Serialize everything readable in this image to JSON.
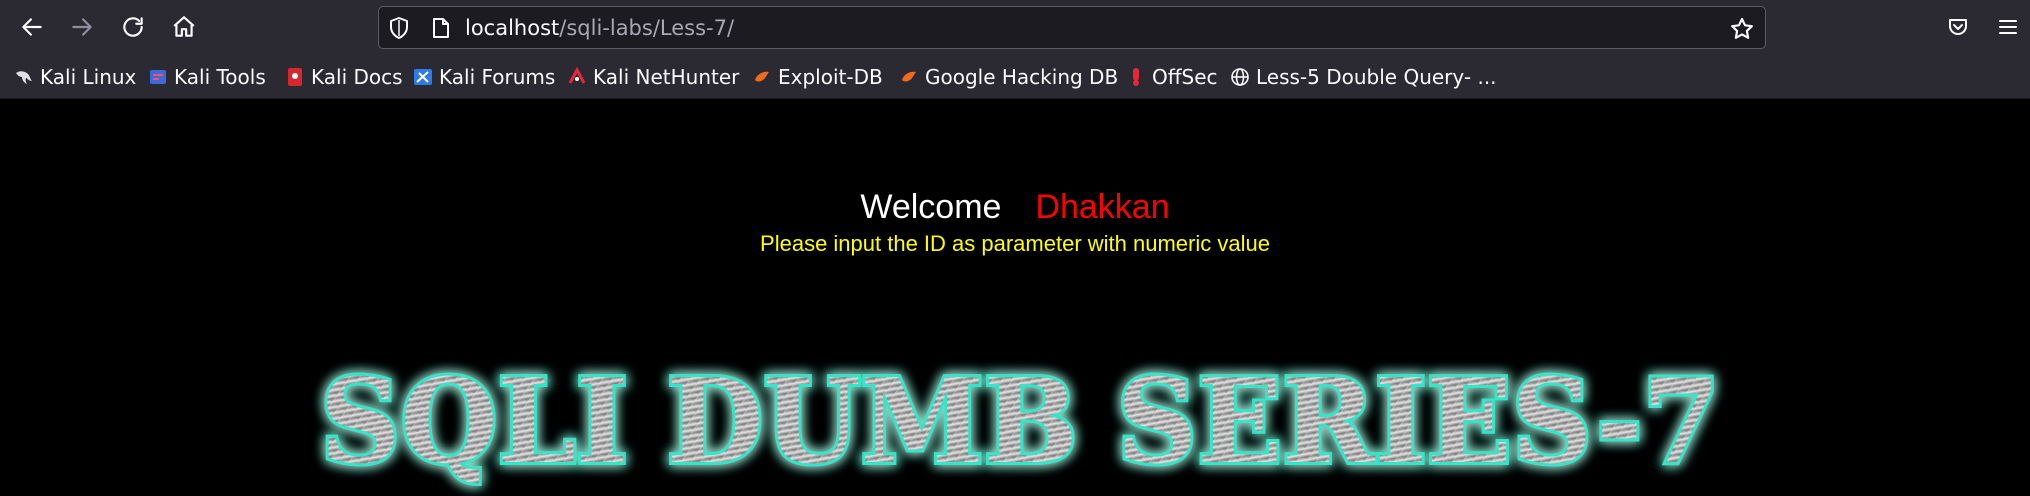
{
  "browser": {
    "url_host": "localhost",
    "url_path": "/sqli-labs/Less-7/",
    "icons": {
      "back": "arrow-left-icon",
      "forward": "arrow-right-icon",
      "reload": "reload-icon",
      "home": "home-icon",
      "shield": "shield-icon",
      "page": "page-icon",
      "bookmark_star": "star-icon",
      "pocket": "pocket-icon",
      "menu": "hamburger-menu-icon"
    }
  },
  "bookmarks": [
    {
      "label": "Kali Linux",
      "icon": "kali-dragon-icon"
    },
    {
      "label": "Kali Tools",
      "icon": "kali-tools-icon"
    },
    {
      "label": "Kali Docs",
      "icon": "kali-docs-icon"
    },
    {
      "label": "Kali Forums",
      "icon": "kali-forums-icon"
    },
    {
      "label": "Kali NetHunter",
      "icon": "nethunter-icon"
    },
    {
      "label": "Exploit-DB",
      "icon": "exploit-db-icon"
    },
    {
      "label": "Google Hacking DB",
      "icon": "ghdb-icon"
    },
    {
      "label": "OffSec",
      "icon": "offsec-icon"
    },
    {
      "label": "Less-5 Double Query- ...",
      "icon": "globe-icon"
    }
  ],
  "page": {
    "welcome": "Welcome",
    "name": "Dhakkan",
    "instruction": "Please input the ID as parameter with numeric value",
    "logo_text": "SQLI DUMB SERIES-7"
  },
  "colors": {
    "toolbar_bg": "#2b2a33",
    "urlbar_bg": "#1c1b22",
    "page_bg": "#000000",
    "welcome_color": "#ffffff",
    "name_color": "#ff0000",
    "instruction_color": "#ffff00",
    "logo_glow": "#33e6c8"
  }
}
